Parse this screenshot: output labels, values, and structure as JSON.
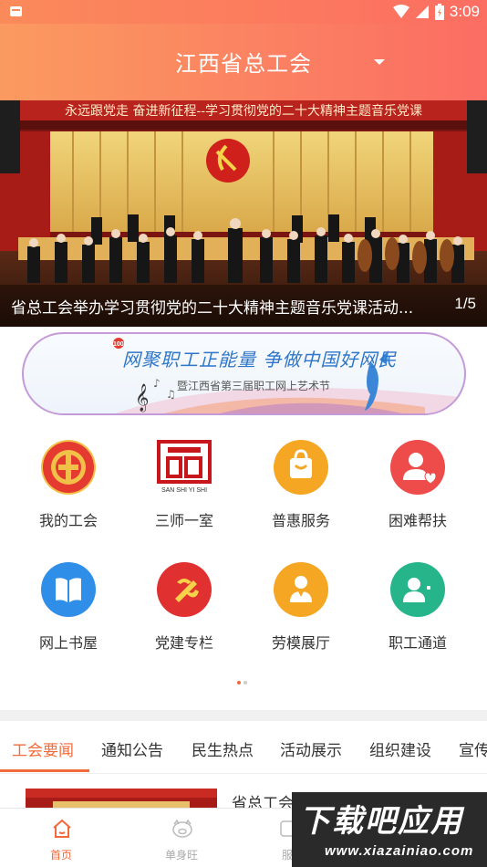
{
  "status_bar": {
    "time": "3:09"
  },
  "header": {
    "title": "江西省总工会"
  },
  "banner": {
    "top_slogan": "永远跟党走 奋进新征程--学习贯彻党的二十大精神主题音乐党课",
    "caption": "省总工会举办学习贯彻党的二十大精神主题音乐党课活动...",
    "counter": "1/5"
  },
  "promo": {
    "line1": "网聚职工正能量 争做中国好网民",
    "line2": "暨江西省第三届职工网上艺术节"
  },
  "grid": [
    {
      "label": "我的工会",
      "icon": "union-emblem-icon",
      "color": "#e53a2f"
    },
    {
      "label": "三师一室",
      "icon": "sanshiyishi-logo-icon",
      "color": "#c8161d"
    },
    {
      "label": "普惠服务",
      "icon": "shopping-bag-icon",
      "color": "#f5a623"
    },
    {
      "label": "困难帮扶",
      "icon": "helping-person-icon",
      "color": "#ee4b4b"
    },
    {
      "label": "网上书屋",
      "icon": "book-icon",
      "color": "#2f8fe8"
    },
    {
      "label": "党建专栏",
      "icon": "party-emblem-icon",
      "color": "#e13030"
    },
    {
      "label": "劳模展厅",
      "icon": "model-worker-icon",
      "color": "#f5a623"
    },
    {
      "label": "职工通道",
      "icon": "worker-channel-icon",
      "color": "#26b58a"
    }
  ],
  "tabs": [
    "工会要闻",
    "通知公告",
    "民生热点",
    "活动展示",
    "组织建设",
    "宣传"
  ],
  "news": {
    "first_title": "省总工会举办学习贯彻党的二十大"
  },
  "bottom_nav": [
    {
      "label": "首页",
      "icon": "home-icon",
      "active": true
    },
    {
      "label": "单身旺",
      "icon": "pig-face-icon",
      "active": false
    },
    {
      "label": "服",
      "icon": "service-icon",
      "active": false
    }
  ],
  "watermark": {
    "big": "下载吧应用",
    "small": "www.xiazainiao.com"
  },
  "colors": {
    "accent": "#f26a3b",
    "header_start": "#fb9a60",
    "header_end": "#fb6d63"
  }
}
